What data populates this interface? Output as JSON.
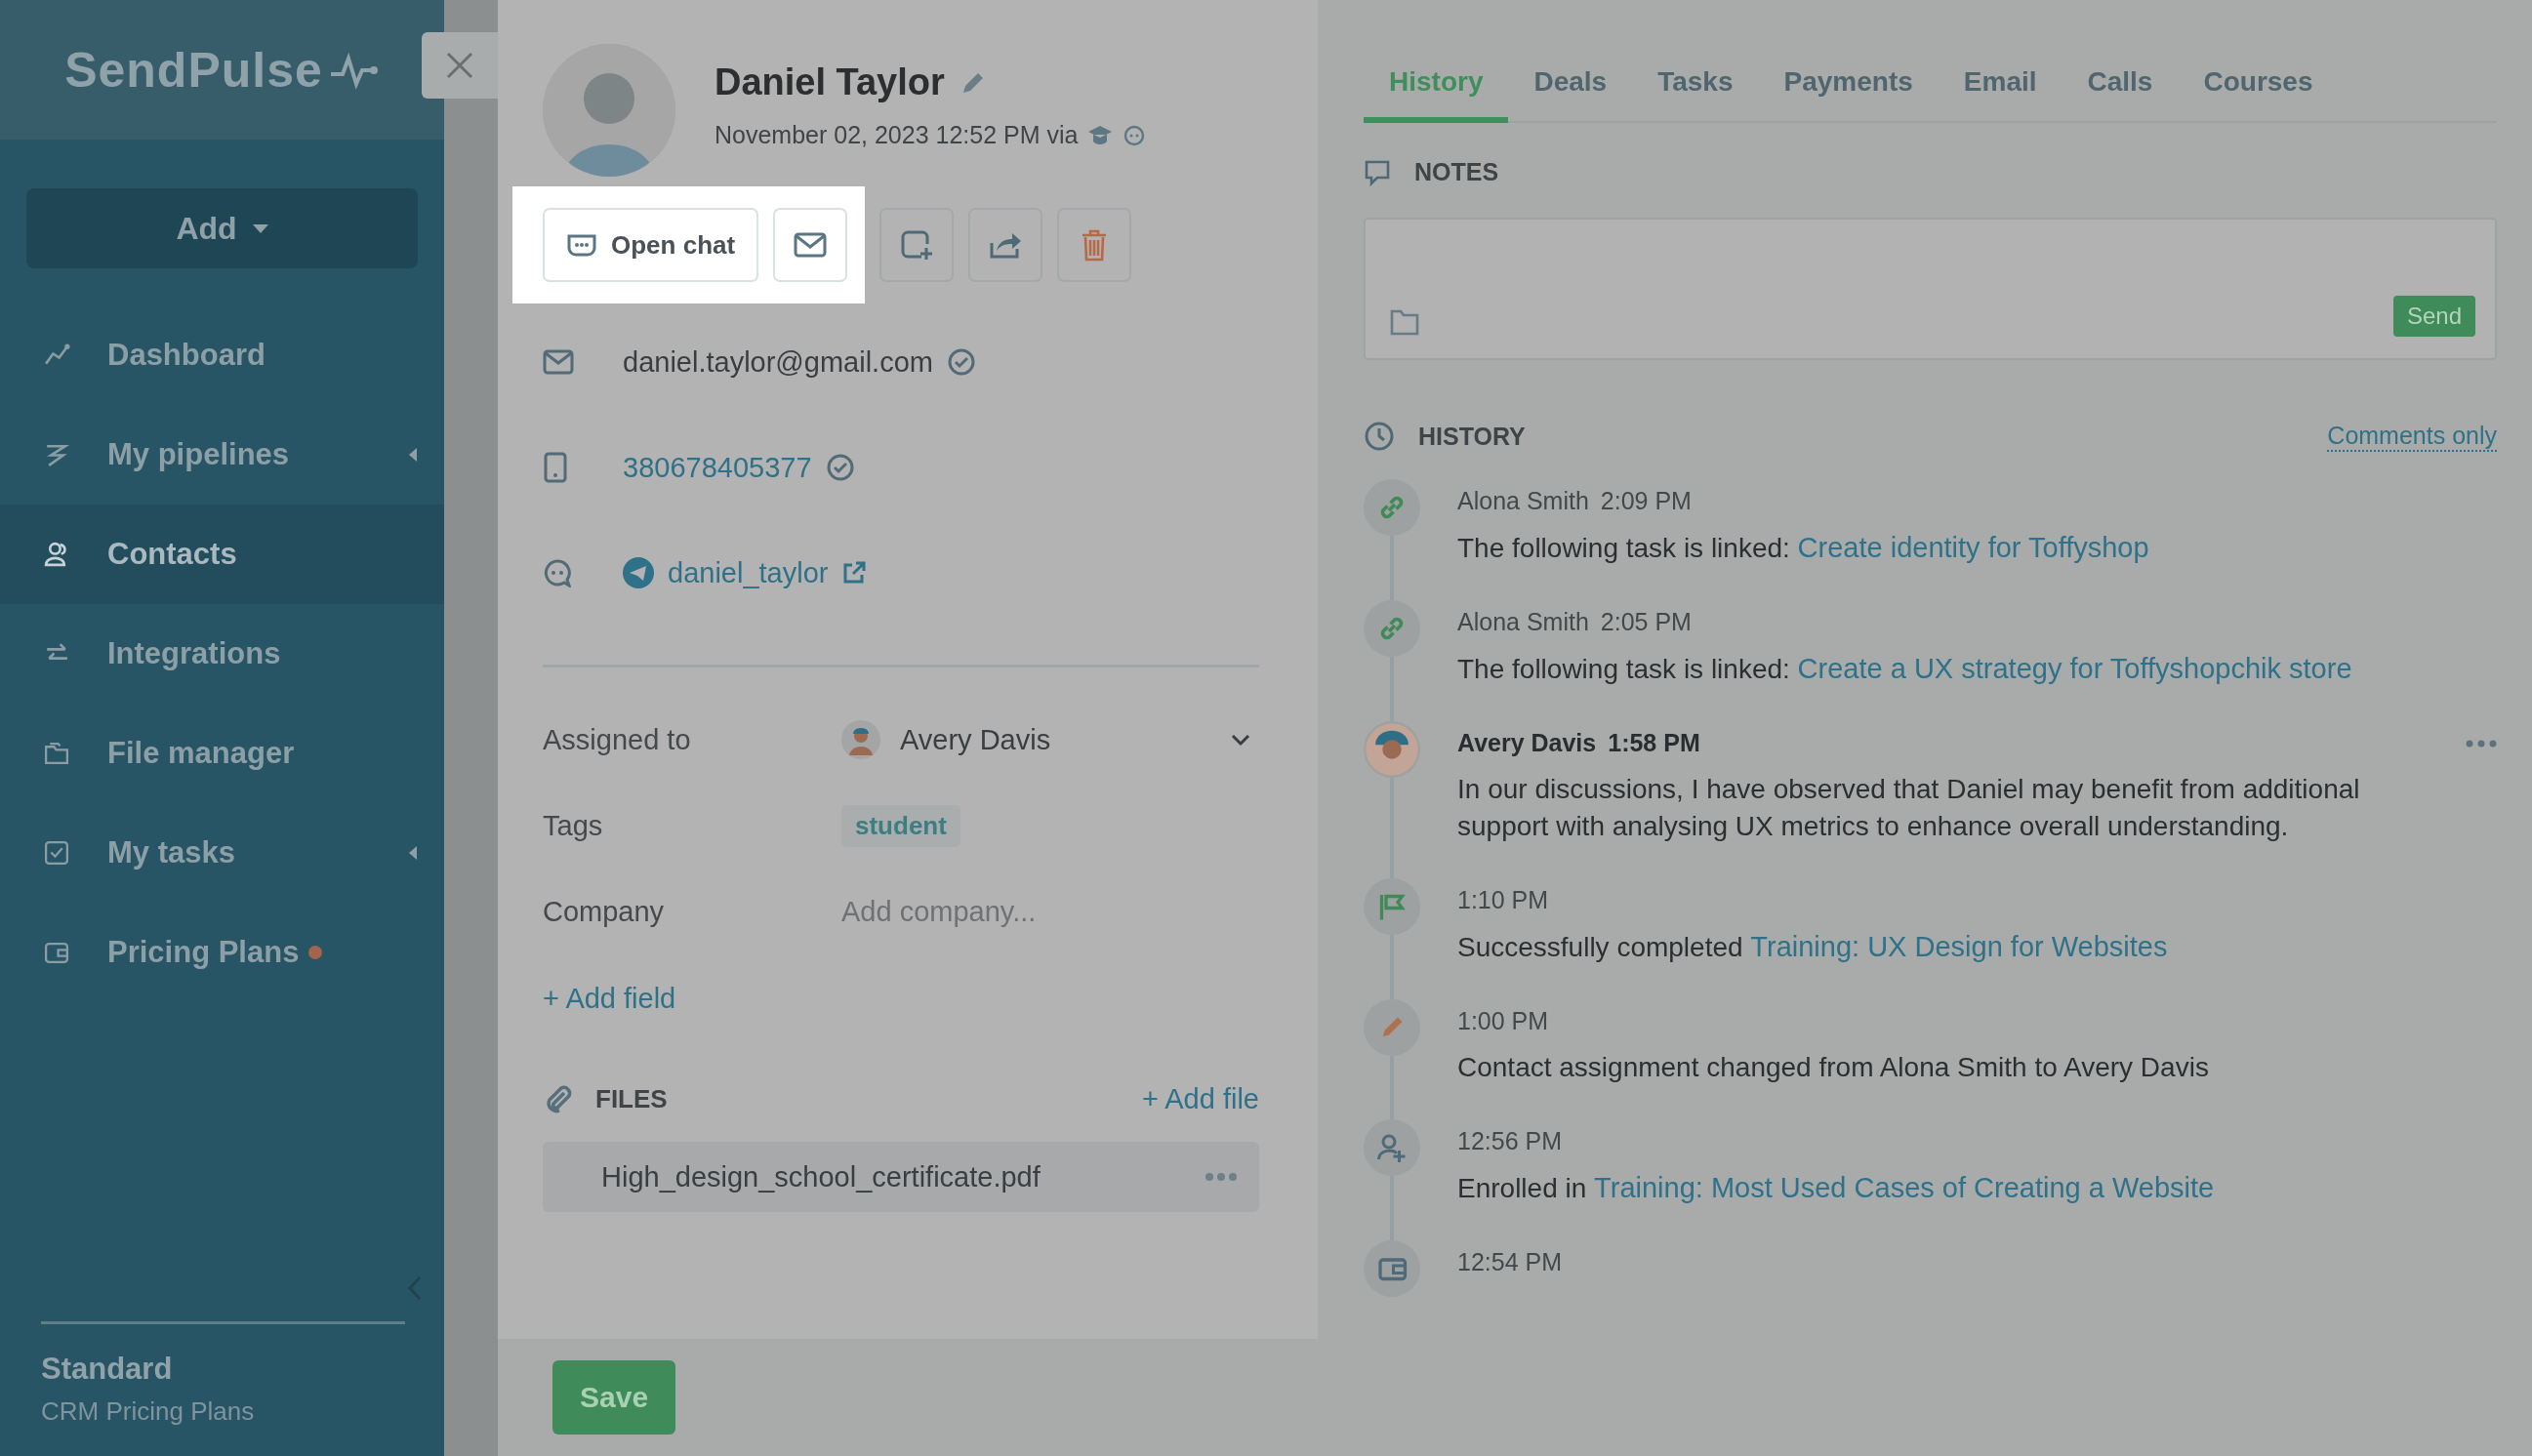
{
  "sidebar": {
    "logo": "SendPulse",
    "add_button": "Add",
    "items": [
      {
        "label": "Dashboard",
        "selected": false,
        "submenu": false,
        "dot": false
      },
      {
        "label": "My pipelines",
        "selected": false,
        "submenu": true,
        "dot": false
      },
      {
        "label": "Contacts",
        "selected": true,
        "submenu": false,
        "dot": false
      },
      {
        "label": "Integrations",
        "selected": false,
        "submenu": false,
        "dot": false
      },
      {
        "label": "File manager",
        "selected": false,
        "submenu": false,
        "dot": false
      },
      {
        "label": "My tasks",
        "selected": false,
        "submenu": true,
        "dot": false
      },
      {
        "label": "Pricing Plans",
        "selected": false,
        "submenu": false,
        "dot": true
      }
    ],
    "plan": {
      "name": "Standard",
      "subtitle": "CRM Pricing Plans"
    }
  },
  "contact": {
    "name": "Daniel Taylor",
    "created": "November 02, 2023 12:52 PM via",
    "open_chat": "Open chat",
    "email": "daniel.taylor@gmail.com",
    "phone": "380678405377",
    "telegram": "daniel_taylor",
    "fields": [
      {
        "kind": "user",
        "label": "Assigned to",
        "value": "Avery Davis"
      },
      {
        "kind": "tag",
        "label": "Tags",
        "value": "student"
      },
      {
        "kind": "input",
        "label": "Company",
        "placeholder": "Add company..."
      }
    ],
    "add_field": "+ Add field",
    "files_title": "FILES",
    "add_file": "+ Add file",
    "files": [
      "High_design_school_certificate.pdf"
    ],
    "save": "Save"
  },
  "tabs": [
    {
      "label": "History",
      "selected": true
    },
    {
      "label": "Deals",
      "selected": false
    },
    {
      "label": "Tasks",
      "selected": false
    },
    {
      "label": "Payments",
      "selected": false
    },
    {
      "label": "Email",
      "selected": false
    },
    {
      "label": "Calls",
      "selected": false
    },
    {
      "label": "Courses",
      "selected": false
    }
  ],
  "notes": {
    "title": "NOTES",
    "send": "Send"
  },
  "history": {
    "title": "HISTORY",
    "filter": "Comments only",
    "entries": [
      {
        "kind": "link",
        "author": "Alona Smith",
        "time": "2:09 PM",
        "text": "The following task is linked:",
        "link": "Create identity for Toffyshop"
      },
      {
        "kind": "link",
        "author": "Alona Smith",
        "time": "2:05 PM",
        "text": "The following task is linked:",
        "link": "Create a UX strategy for Toffyshopchik store"
      },
      {
        "kind": "comment",
        "author": "Avery Davis",
        "time": "1:58 PM",
        "text": "In our discussions, I have observed that Daniel may benefit from additional support with analysing UX metrics to enhance overall understanding."
      },
      {
        "kind": "flag",
        "time": "1:10 PM",
        "text": "Successfully completed",
        "link": "Training: UX Design for Websites"
      },
      {
        "kind": "edit",
        "time": "1:00 PM",
        "text": "Contact assignment changed from Alona Smith to Avery Davis"
      },
      {
        "kind": "enroll",
        "time": "12:56 PM",
        "text": "Enrolled in",
        "link": "Training: Most Used Cases of Creating a Website"
      },
      {
        "kind": "wallet",
        "time": "12:54 PM"
      }
    ]
  }
}
